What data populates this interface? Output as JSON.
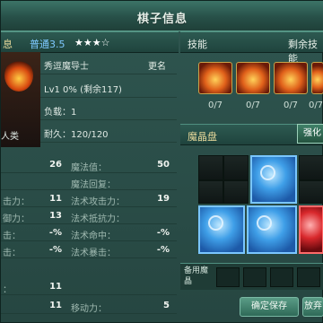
{
  "window": {
    "title": "棋子信息"
  },
  "left": {
    "tab_label": "息",
    "quality": "普通3.5",
    "stars": "★★★☆",
    "name": "秀逗魔导士",
    "rename": "更名",
    "level": "Lv1 0% (剩余117)",
    "load": "负载：1",
    "durability": "耐久：120/120",
    "race": "人类"
  },
  "stats": {
    "rows": [
      {
        "l1": "",
        "v1": "26",
        "l2": "魔法值：",
        "v2": "50"
      },
      {
        "l1": "",
        "v1": "",
        "l2": "魔法回复：",
        "v2": ""
      },
      {
        "l1": "击力：",
        "v1": "11",
        "l2": "法术攻击力：",
        "v2": "19"
      },
      {
        "l1": "御力：",
        "v1": "13",
        "l2": "法术抵抗力：",
        "v2": ""
      },
      {
        "l1": "击：",
        "v1": "-%",
        "l2": "法术命中：",
        "v2": "-%"
      },
      {
        "l1": "击：",
        "v1": "-%",
        "l2": "法术暴击：",
        "v2": "-%"
      },
      {
        "l1": "：",
        "v1": "11",
        "l2": "",
        "v2": ""
      },
      {
        "l1": "",
        "v1": "11",
        "l2": "移动力：",
        "v2": "5"
      }
    ]
  },
  "skills": {
    "title": "技能",
    "remain": "剩余技能",
    "counts": [
      "0/7",
      "0/7",
      "0/7",
      "0/7"
    ]
  },
  "crystal": {
    "title": "魔晶盘",
    "strengthen": "强化",
    "spare": "备用魔晶",
    "confirm": "确定保存",
    "reset": "放弃"
  },
  "colors": {
    "title_bar": "#275048",
    "panel": "#264641",
    "accent": "#c9a24a"
  }
}
